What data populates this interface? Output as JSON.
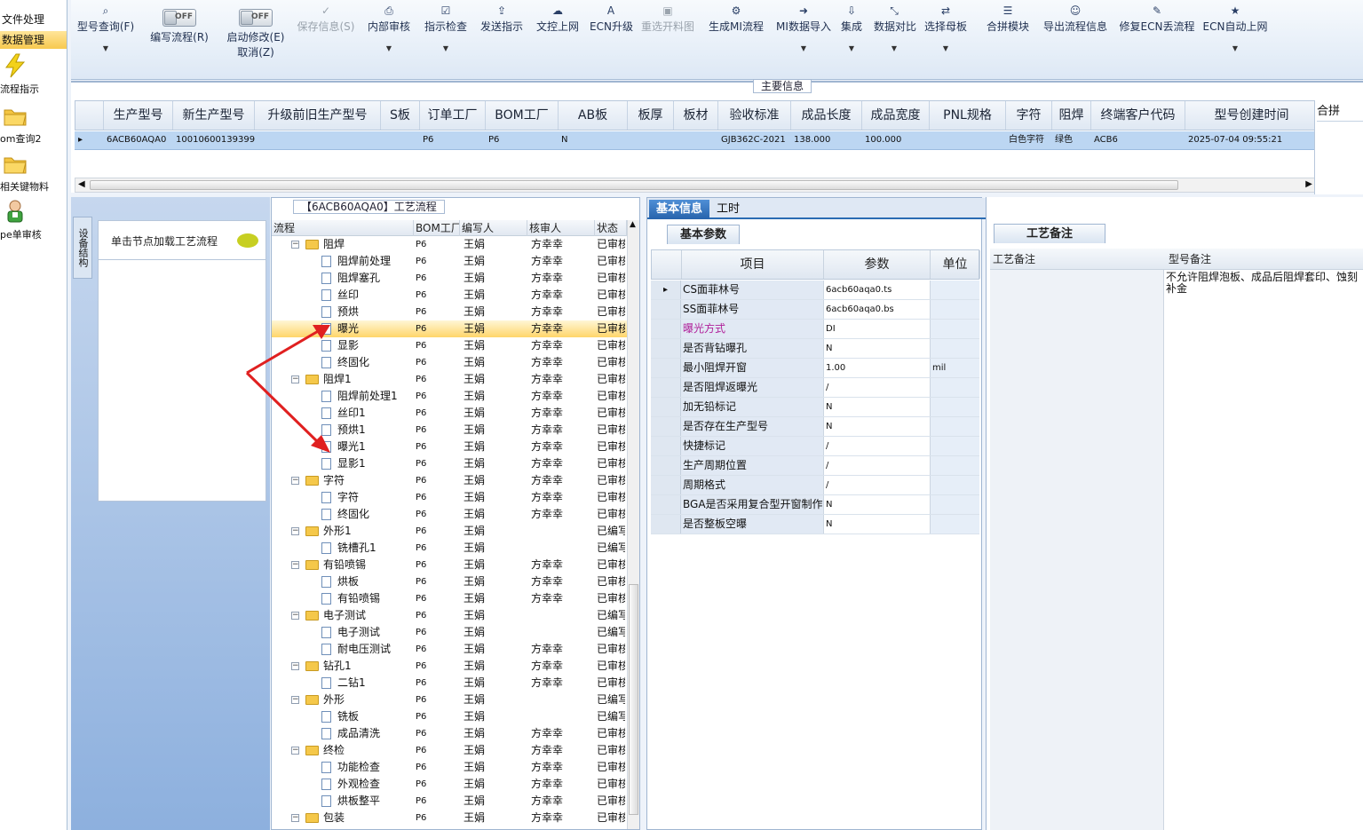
{
  "sidebar": {
    "top_items": [
      "文件处理",
      "数据管理"
    ],
    "items": [
      {
        "label": "流程指示",
        "icon": "lightning-icon"
      },
      {
        "label": "om查询2",
        "icon": "folder-icon"
      },
      {
        "label": "相关键物料",
        "icon": "folder-icon"
      },
      {
        "label": "pe单审核",
        "icon": "user-icon"
      }
    ]
  },
  "toolbar": {
    "buttons": [
      {
        "label": "型号查询(F)",
        "icon": "search-icon",
        "caret": true
      },
      {
        "label": "编写流程(R)",
        "toggle": "OFF"
      },
      {
        "label": "启动修改(E)",
        "sub": "取消(Z)",
        "toggle": "OFF"
      },
      {
        "label": "保存信息(S)",
        "icon": "check-icon",
        "disabled": true
      },
      {
        "label": "内部审核",
        "icon": "print-icon",
        "caret": true
      },
      {
        "label": "指示检查",
        "icon": "checkbox-icon",
        "caret": true
      },
      {
        "label": "发送指示",
        "icon": "upload-icon"
      },
      {
        "label": "文控上网",
        "icon": "cloud-upload-icon"
      },
      {
        "label": "ECN升级",
        "icon": "font-icon"
      },
      {
        "label": "重选开料图",
        "icon": "image-icon",
        "disabled": true
      },
      {
        "label": "生成MI流程",
        "icon": "cogs-icon"
      },
      {
        "label": "MI数据导入",
        "icon": "sign-in-icon",
        "caret": true
      },
      {
        "label": "集成",
        "icon": "download-icon",
        "caret": true
      },
      {
        "label": "数据对比",
        "icon": "compress-icon",
        "caret": true
      },
      {
        "label": "选择母板",
        "icon": "shuffle-icon",
        "caret": true
      },
      {
        "label": "合拼模块",
        "icon": "list-icon"
      },
      {
        "label": "导出流程信息",
        "icon": "smile-icon"
      },
      {
        "label": "修复ECN丢流程",
        "icon": "wrench-icon"
      },
      {
        "label": "ECN自动上网",
        "icon": "star-icon",
        "caret": true
      }
    ],
    "toggle_text": "OFF"
  },
  "main_info": {
    "title": "主要信息",
    "columns": [
      "生产型号",
      "新生产型号",
      "升级前旧生产型号",
      "S板",
      "订单工厂",
      "BOM工厂",
      "AB板",
      "板厚",
      "板材",
      "验收标准",
      "成品长度",
      "成品宽度",
      "PNL规格",
      "字符",
      "阻焊",
      "终端客户代码",
      "型号创建时间",
      "合拼"
    ],
    "row": [
      "6ACB60AQA0",
      "10010600139399",
      "",
      "",
      "P6",
      "P6",
      "N",
      "",
      "",
      "GJB362C-2021",
      "138.000",
      "100.000",
      "",
      "白色字符",
      "绿色",
      "ACB6",
      "2025-07-04 09:55:21",
      ""
    ]
  },
  "left_panel": {
    "vertical_tab": "设备结构",
    "load_hint": "单击节点加载工艺流程"
  },
  "process": {
    "title": "【6ACB60AQA0】工艺流程",
    "columns": [
      "流程",
      "BOM工厂",
      "编写人",
      "核审人",
      "状态"
    ],
    "rows": [
      {
        "name": "阻焊",
        "level": 0,
        "bom": "P6",
        "writer": "王娟",
        "reviewer": "方幸幸",
        "status": "已审核"
      },
      {
        "name": "阻焊前处理",
        "level": 1,
        "bom": "P6",
        "writer": "王娟",
        "reviewer": "方幸幸",
        "status": "已审核"
      },
      {
        "name": "阻焊塞孔",
        "level": 1,
        "bom": "P6",
        "writer": "王娟",
        "reviewer": "方幸幸",
        "status": "已审核"
      },
      {
        "name": "丝印",
        "level": 1,
        "bom": "P6",
        "writer": "王娟",
        "reviewer": "方幸幸",
        "status": "已审核"
      },
      {
        "name": "预烘",
        "level": 1,
        "bom": "P6",
        "writer": "王娟",
        "reviewer": "方幸幸",
        "status": "已审核"
      },
      {
        "name": "曝光",
        "level": 1,
        "bom": "P6",
        "writer": "王娟",
        "reviewer": "方幸幸",
        "status": "已审核",
        "selected": true
      },
      {
        "name": "显影",
        "level": 1,
        "bom": "P6",
        "writer": "王娟",
        "reviewer": "方幸幸",
        "status": "已审核"
      },
      {
        "name": "终固化",
        "level": 1,
        "bom": "P6",
        "writer": "王娟",
        "reviewer": "方幸幸",
        "status": "已审核"
      },
      {
        "name": "阻焊1",
        "level": 0,
        "bom": "P6",
        "writer": "王娟",
        "reviewer": "方幸幸",
        "status": "已审核"
      },
      {
        "name": "阻焊前处理1",
        "level": 1,
        "bom": "P6",
        "writer": "王娟",
        "reviewer": "方幸幸",
        "status": "已审核"
      },
      {
        "name": "丝印1",
        "level": 1,
        "bom": "P6",
        "writer": "王娟",
        "reviewer": "方幸幸",
        "status": "已审核"
      },
      {
        "name": "预烘1",
        "level": 1,
        "bom": "P6",
        "writer": "王娟",
        "reviewer": "方幸幸",
        "status": "已审核"
      },
      {
        "name": "曝光1",
        "level": 1,
        "bom": "P6",
        "writer": "王娟",
        "reviewer": "方幸幸",
        "status": "已审核"
      },
      {
        "name": "显影1",
        "level": 1,
        "bom": "P6",
        "writer": "王娟",
        "reviewer": "方幸幸",
        "status": "已审核"
      },
      {
        "name": "字符",
        "level": 0,
        "bom": "P6",
        "writer": "王娟",
        "reviewer": "方幸幸",
        "status": "已审核"
      },
      {
        "name": "字符",
        "level": 1,
        "bom": "P6",
        "writer": "王娟",
        "reviewer": "方幸幸",
        "status": "已审核"
      },
      {
        "name": "终固化",
        "level": 1,
        "bom": "P6",
        "writer": "王娟",
        "reviewer": "方幸幸",
        "status": "已审核"
      },
      {
        "name": "外形1",
        "level": 0,
        "bom": "P6",
        "writer": "王娟",
        "reviewer": "",
        "status": "已编写"
      },
      {
        "name": "铣槽孔1",
        "level": 1,
        "bom": "P6",
        "writer": "王娟",
        "reviewer": "",
        "status": "已编写"
      },
      {
        "name": "有铅喷锡",
        "level": 0,
        "bom": "P6",
        "writer": "王娟",
        "reviewer": "方幸幸",
        "status": "已审核"
      },
      {
        "name": "烘板",
        "level": 1,
        "bom": "P6",
        "writer": "王娟",
        "reviewer": "方幸幸",
        "status": "已审核"
      },
      {
        "name": "有铅喷锡",
        "level": 1,
        "bom": "P6",
        "writer": "王娟",
        "reviewer": "方幸幸",
        "status": "已审核"
      },
      {
        "name": "电子测试",
        "level": 0,
        "bom": "P6",
        "writer": "王娟",
        "reviewer": "",
        "status": "已编写"
      },
      {
        "name": "电子测试",
        "level": 1,
        "bom": "P6",
        "writer": "王娟",
        "reviewer": "",
        "status": "已编写"
      },
      {
        "name": "耐电压测试",
        "level": 1,
        "bom": "P6",
        "writer": "王娟",
        "reviewer": "方幸幸",
        "status": "已审核"
      },
      {
        "name": "钻孔1",
        "level": 0,
        "bom": "P6",
        "writer": "王娟",
        "reviewer": "方幸幸",
        "status": "已审核"
      },
      {
        "name": "二钻1",
        "level": 1,
        "bom": "P6",
        "writer": "王娟",
        "reviewer": "方幸幸",
        "status": "已审核"
      },
      {
        "name": "外形",
        "level": 0,
        "bom": "P6",
        "writer": "王娟",
        "reviewer": "",
        "status": "已编写"
      },
      {
        "name": "铣板",
        "level": 1,
        "bom": "P6",
        "writer": "王娟",
        "reviewer": "",
        "status": "已编写"
      },
      {
        "name": "成品清洗",
        "level": 1,
        "bom": "P6",
        "writer": "王娟",
        "reviewer": "方幸幸",
        "status": "已审核"
      },
      {
        "name": "终检",
        "level": 0,
        "bom": "P6",
        "writer": "王娟",
        "reviewer": "方幸幸",
        "status": "已审核"
      },
      {
        "name": "功能检查",
        "level": 1,
        "bom": "P6",
        "writer": "王娟",
        "reviewer": "方幸幸",
        "status": "已审核"
      },
      {
        "name": "外观检查",
        "level": 1,
        "bom": "P6",
        "writer": "王娟",
        "reviewer": "方幸幸",
        "status": "已审核"
      },
      {
        "name": "烘板整平",
        "level": 1,
        "bom": "P6",
        "writer": "王娟",
        "reviewer": "方幸幸",
        "status": "已审核"
      },
      {
        "name": "包装",
        "level": 0,
        "bom": "P6",
        "writer": "王娟",
        "reviewer": "方幸幸",
        "status": "已审核"
      }
    ]
  },
  "basic": {
    "tabs": [
      "基本信息",
      "工时"
    ],
    "subtab": "基本参数",
    "columns": [
      "项目",
      "参数",
      "单位"
    ],
    "rows": [
      {
        "key": "CS面菲林号",
        "value": "6acb60aqa0.ts",
        "unit": ""
      },
      {
        "key": "SS面菲林号",
        "value": "6acb60aqa0.bs",
        "unit": ""
      },
      {
        "key": "曝光方式",
        "value": "DI",
        "unit": "",
        "highlight": true
      },
      {
        "key": "是否背钻曝孔",
        "value": "N",
        "unit": ""
      },
      {
        "key": "最小阻焊开窗",
        "value": "1.00",
        "unit": "mil"
      },
      {
        "key": "是否阻焊返曝光",
        "value": "/",
        "unit": ""
      },
      {
        "key": "加无铅标记",
        "value": "N",
        "unit": ""
      },
      {
        "key": "是否存在生产型号",
        "value": "N",
        "unit": ""
      },
      {
        "key": "快捷标记",
        "value": "/",
        "unit": ""
      },
      {
        "key": "生产周期位置",
        "value": "/",
        "unit": ""
      },
      {
        "key": "周期格式",
        "value": "/",
        "unit": ""
      },
      {
        "key": "BGA是否采用复合型开窗制作",
        "value": "N",
        "unit": ""
      },
      {
        "key": "是否整板空曝",
        "value": "N",
        "unit": ""
      }
    ]
  },
  "notes": {
    "tab": "工艺备注",
    "columns": [
      "工艺备注",
      "型号备注"
    ],
    "model_note": "不允许阻焊泡板、成品后阻焊套印、蚀刻补金"
  },
  "colors": {
    "accent": "#2b6cb3",
    "selected_row": "#ffd56a",
    "grid_selected": "#bcd6f2",
    "arrow": "#e02020",
    "highlight_text": "#b0209a"
  }
}
